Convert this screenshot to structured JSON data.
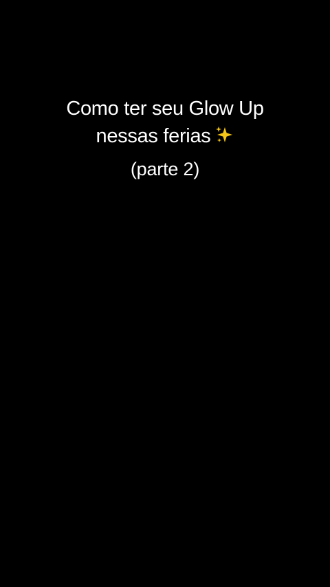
{
  "caption": {
    "line1": "Como ter seu Glow Up",
    "line2": "nessas ferias",
    "line2_icon": "sparkles-icon",
    "subtitle": "(parte 2)"
  },
  "colors": {
    "background": "#000000",
    "text": "#ffffff",
    "sparkle": "#f5c518"
  }
}
